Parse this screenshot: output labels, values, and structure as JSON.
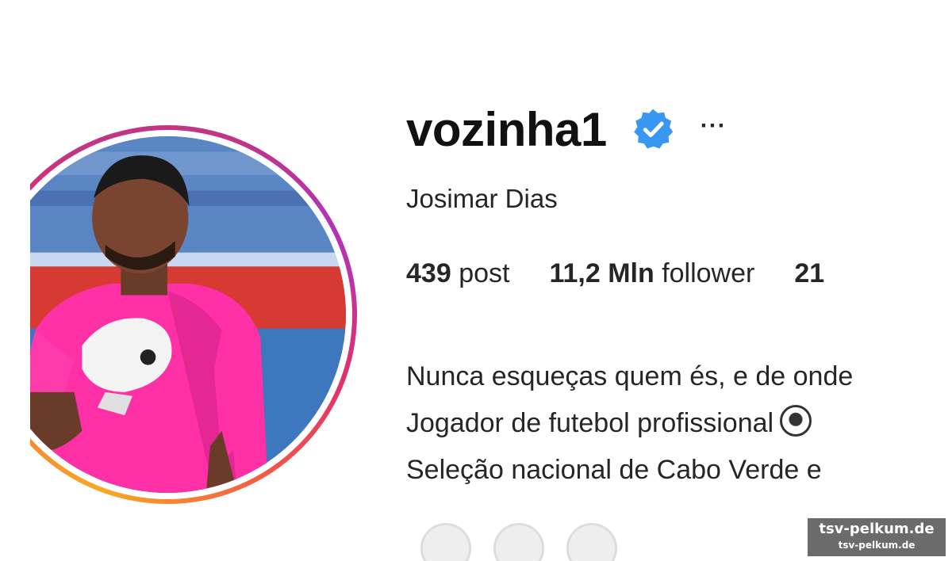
{
  "profile": {
    "username": "vozinha1",
    "verified": true,
    "more_label": "···",
    "full_name": "Josimar Dias"
  },
  "stats": {
    "posts_value": "439",
    "posts_label": "post",
    "followers_value": "11,2 Mln",
    "followers_label": "follower",
    "following_value": "21"
  },
  "bio": {
    "line1": "Nunca esqueças quem és, e de onde",
    "line2": "Jogador de futebol profissional",
    "line2_icon": "soccer-ball-icon",
    "line3": "Seleção nacional de Cabo Verde e"
  },
  "watermark": {
    "main": "tsv-pelkum.de",
    "sub": "tsv-pelkum.de"
  },
  "colors": {
    "verified_blue": "#3897f0",
    "ring_pink": "#c13584",
    "ring_orange": "#f77737",
    "jersey_pink": "#ff2fa6"
  }
}
